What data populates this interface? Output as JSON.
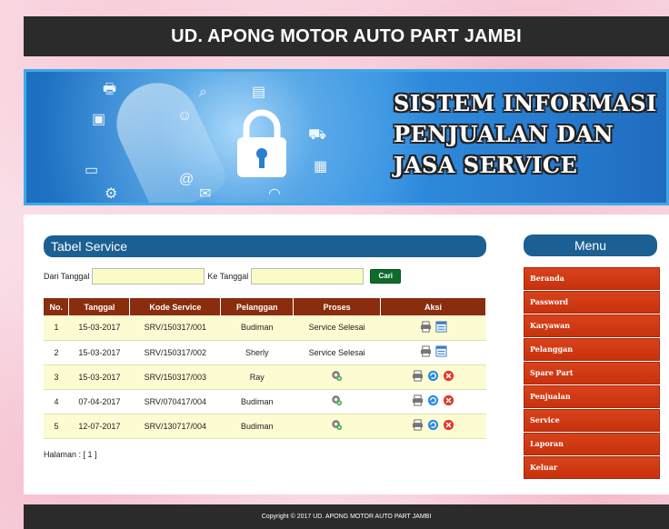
{
  "header": {
    "title": "UD. APONG MOTOR AUTO PART JAMBI"
  },
  "banner": {
    "title": "SISTEM INFORMASI PENJUALAN DAN JASA SERVICE"
  },
  "panel": {
    "title": "Tabel Service"
  },
  "filter": {
    "from_label": "Dari Tanggal",
    "from_value": "",
    "to_label": "Ke Tanggal",
    "to_value": "",
    "search_label": "Cari"
  },
  "table": {
    "headers": [
      "No.",
      "Tanggal",
      "Kode Service",
      "Pelanggan",
      "Proses",
      "Aksi"
    ],
    "rows": [
      {
        "no": "1",
        "tanggal": "15-03-2017",
        "kode": "SRV/150317/001",
        "pelanggan": "Budiman",
        "proses": "Service Selesai"
      },
      {
        "no": "2",
        "tanggal": "15-03-2017",
        "kode": "SRV/150317/002",
        "pelanggan": "Sherly",
        "proses": "Service Selesai"
      },
      {
        "no": "3",
        "tanggal": "15-03-2017",
        "kode": "SRV/150317/003",
        "pelanggan": "Ray",
        "proses": ""
      },
      {
        "no": "4",
        "tanggal": "07-04-2017",
        "kode": "SRV/070417/004",
        "pelanggan": "Budiman",
        "proses": ""
      },
      {
        "no": "5",
        "tanggal": "12-07-2017",
        "kode": "SRV/130717/004",
        "pelanggan": "Budiman",
        "proses": ""
      }
    ]
  },
  "pagination": {
    "text": "Halaman : [ 1 ]"
  },
  "menu": {
    "title": "Menu",
    "items": [
      "Beranda",
      "Password",
      "Karyawan",
      "Pelanggan",
      "Spare Part",
      "Penjualan",
      "Service",
      "Laporan",
      "Keluar"
    ]
  },
  "footer": {
    "text": "Copyright © 2017 UD. APONG MOTOR AUTO PART JAMBI"
  },
  "colors": {
    "header_bg": "#2b2b2b",
    "panel_title": "#1b5f93",
    "table_header": "#8a2c0e",
    "menu_item": "#d23a14",
    "row_highlight": "#fdfbd2"
  }
}
